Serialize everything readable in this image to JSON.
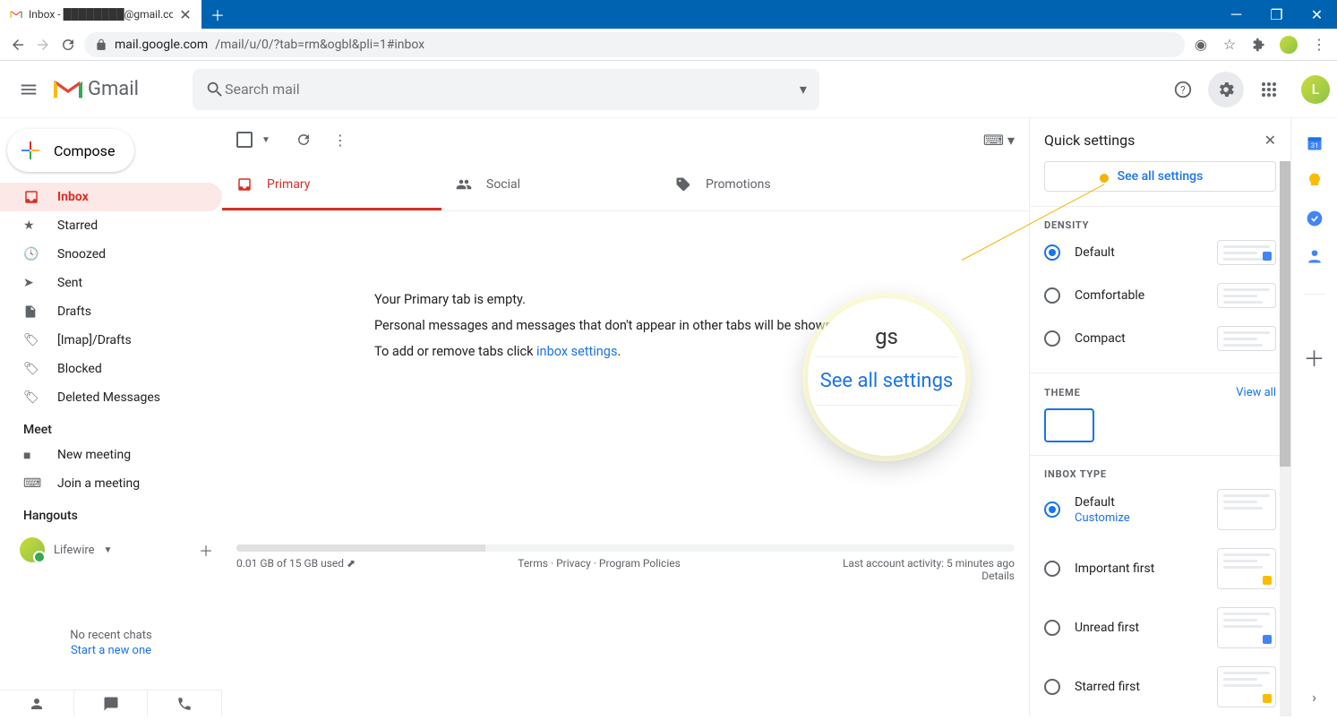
{
  "browser": {
    "tab_title": "Inbox - ████████@gmail.com",
    "url_host": "mail.google.com",
    "url_path": "/mail/u/0/?tab=rm&ogbl&pli=1#inbox"
  },
  "header": {
    "logo_text": "Gmail",
    "search_placeholder": "Search mail",
    "avatar_initial": "L"
  },
  "compose_label": "Compose",
  "nav": {
    "inbox": "Inbox",
    "starred": "Starred",
    "snoozed": "Snoozed",
    "sent": "Sent",
    "drafts": "Drafts",
    "imap_drafts": "[Imap]/Drafts",
    "blocked": "Blocked",
    "deleted": "Deleted Messages"
  },
  "meet": {
    "heading": "Meet",
    "new_meeting": "New meeting",
    "join_meeting": "Join a meeting"
  },
  "hangouts": {
    "heading": "Hangouts",
    "user": "Lifewire",
    "no_chats": "No recent chats",
    "start_one": "Start a new one"
  },
  "tabs": {
    "primary": "Primary",
    "social": "Social",
    "promotions": "Promotions"
  },
  "empty_state": {
    "title": "Your Primary tab is empty.",
    "line2_a": "Personal messages and messages that don't appear in other tabs will be shown ",
    "line3_a": "To add or remove tabs click ",
    "link": "inbox settings",
    "dot": "."
  },
  "footer": {
    "storage": "0.01 GB of 15 GB used",
    "terms": "Terms",
    "privacy": "Privacy",
    "policies": "Program Policies",
    "activity": "Last account activity: 5 minutes ago",
    "details": "Details"
  },
  "quick": {
    "title": "Quick settings",
    "see_all": "See all settings",
    "density": "DENSITY",
    "d_default": "Default",
    "d_comfortable": "Comfortable",
    "d_compact": "Compact",
    "theme": "THEME",
    "view_all": "View all",
    "inbox_type": "INBOX TYPE",
    "it_default": "Default",
    "it_customize": "Customize",
    "it_important": "Important first",
    "it_unread": "Unread first",
    "it_starred": "Starred first"
  },
  "magnifier": {
    "frag": "gs",
    "link": "See all settings"
  }
}
